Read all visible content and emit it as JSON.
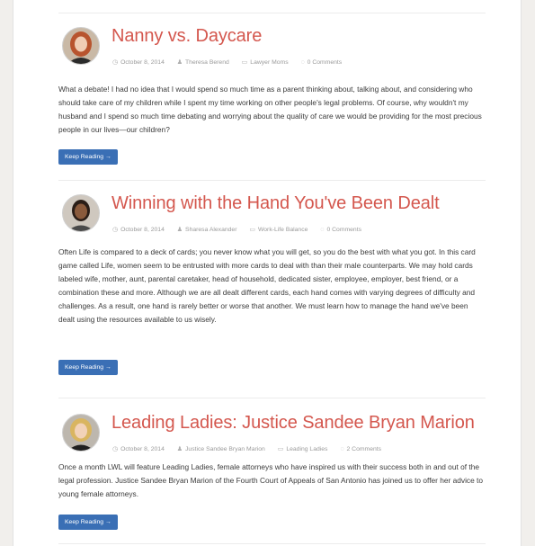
{
  "posts": [
    {
      "title": "Nanny vs. Daycare",
      "date": "October 8, 2014",
      "author": "Theresa Berend",
      "category": "Lawyer Moms",
      "comments": "0 Comments",
      "excerpt": "What a debate! I had no idea that I would spend so much time as a parent thinking about, talking about, and considering who should take care of my children while I spent my time working on other people's legal problems. Of course, why wouldn't my husband and I spend so much time debating and worrying about the quality of care we would be providing for the most precious people in our lives—our children?",
      "button": "Keep Reading →"
    },
    {
      "title": "Winning with the Hand You've Been Dealt",
      "date": "October 8, 2014",
      "author": "Sharesa Alexander",
      "category": "Work-Life Balance",
      "comments": "0 Comments",
      "excerpt": "Often Life is compared to a deck of cards; you never know what you will get, so you do the best with what you got. In this card game called Life, women seem to be entrusted with more cards to deal with than their male counterparts. We may hold cards labeled wife, mother, aunt, parental caretaker, head of household, dedicated sister, employee, employer, best friend, or a combination these and more. Although we are all dealt different cards, each hand comes with varying degrees of difficulty and challenges. As a result, one hand is rarely better or worse that another. We must learn how to manage the hand we've been dealt using the resources available to us wisely.",
      "button": "Keep Reading →"
    },
    {
      "title": "Leading Ladies: Justice Sandee Bryan Marion",
      "date": "October 8, 2014",
      "author": "Justice Sandee Bryan Marion",
      "category": "Leading Ladies",
      "comments": "2 Comments",
      "excerpt": "Once a month LWL will feature Leading Ladies, female attorneys who have inspired us with their success both in and out of the legal profession. Justice Sandee Bryan Marion of the Fourth Court of Appeals of San Antonio has joined us to offer her advice to young female attorneys.",
      "button": "Keep Reading →"
    }
  ],
  "icons": {
    "date": "clock-icon",
    "author": "user-icon",
    "category": "folder-icon",
    "comments": "comment-icon"
  },
  "colors": {
    "title": "#d4574e",
    "button": "#3a6fb5",
    "text": "#3a3a3a",
    "meta": "#9a9a9a"
  }
}
